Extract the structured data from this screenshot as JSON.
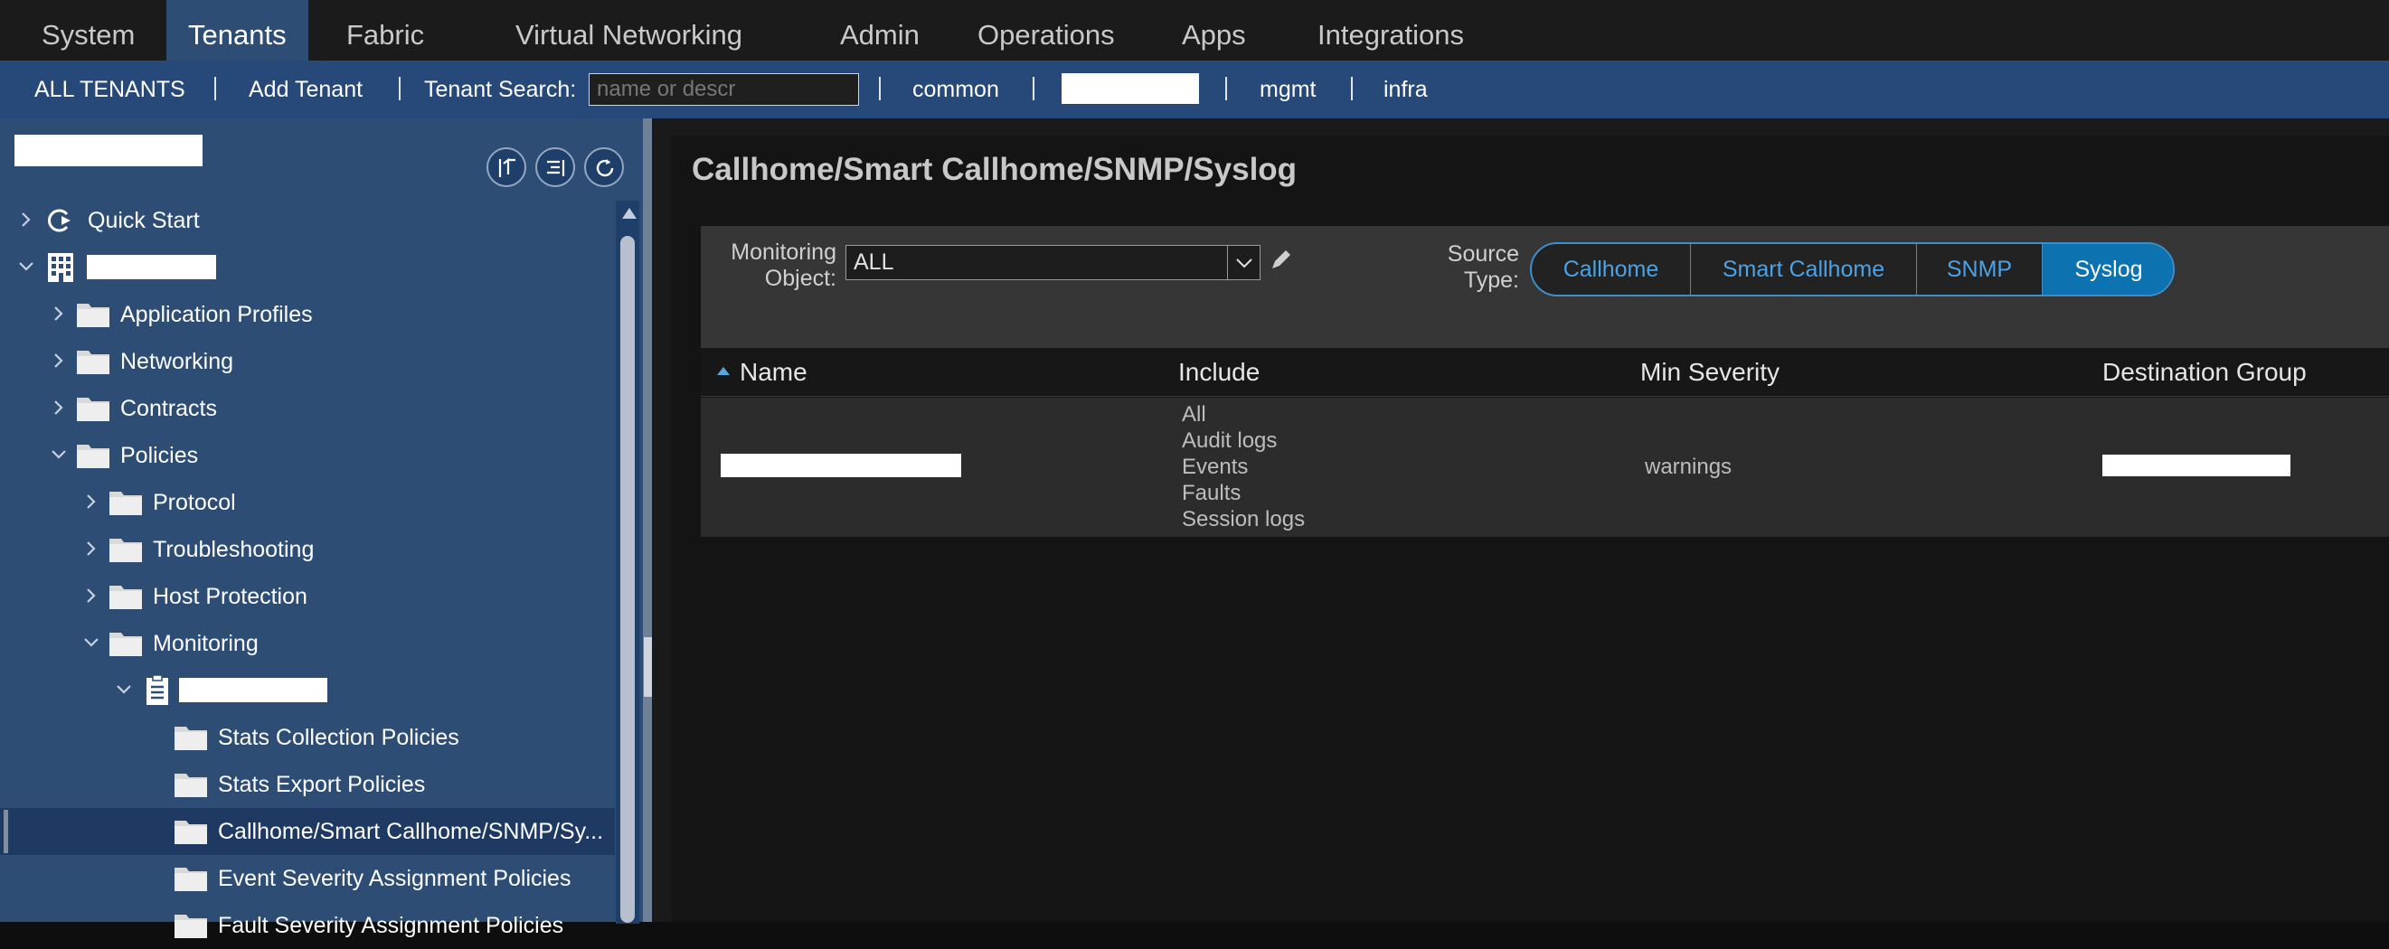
{
  "top_nav": {
    "tabs": [
      "System",
      "Tenants",
      "Fabric",
      "Virtual Networking",
      "Admin",
      "Operations",
      "Apps",
      "Integrations"
    ],
    "active": "Tenants"
  },
  "sub_nav": {
    "all_tenants": "ALL TENANTS",
    "add_tenant": "Add Tenant",
    "search_label": "Tenant Search:",
    "search_placeholder": "name or descr",
    "tenants": [
      "common",
      "mgmt",
      "infra"
    ]
  },
  "sidebar": {
    "tree": {
      "quick_start": "Quick Start",
      "application_profiles": "Application Profiles",
      "networking": "Networking",
      "contracts": "Contracts",
      "policies": "Policies",
      "protocol": "Protocol",
      "troubleshooting": "Troubleshooting",
      "host_protection": "Host Protection",
      "monitoring": "Monitoring",
      "stats_collection": "Stats Collection Policies",
      "stats_export": "Stats Export Policies",
      "callhome": "Callhome/Smart Callhome/SNMP/Sy...",
      "event_severity": "Event Severity Assignment Policies",
      "fault_severity": "Fault Severity Assignment Policies"
    }
  },
  "main": {
    "title": "Callhome/Smart Callhome/SNMP/Syslog",
    "monitoring_object_label_1": "Monitoring",
    "monitoring_object_label_2": "Object:",
    "monitoring_object_value": "ALL",
    "source_type_label_1": "Source",
    "source_type_label_2": "Type:",
    "source_types": [
      "Callhome",
      "Smart Callhome",
      "SNMP",
      "Syslog"
    ],
    "source_type_selected": "Syslog",
    "table": {
      "columns": [
        "Name",
        "Include",
        "Min Severity",
        "Destination Group"
      ],
      "rows": [
        {
          "include": [
            "All",
            "Audit logs",
            "Events",
            "Faults",
            "Session logs"
          ],
          "min_severity": "warnings"
        }
      ]
    }
  },
  "colors": {
    "top_nav_bg": "#1b1b1b",
    "sub_nav_bg": "#27497a",
    "sidebar_bg": "#2d4d75",
    "accent": "#0d72b0",
    "segment_text": "#4aa3e6"
  }
}
